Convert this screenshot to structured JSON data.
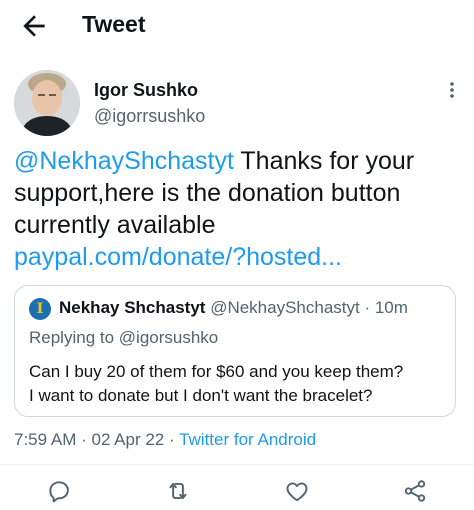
{
  "header": {
    "title": "Tweet",
    "back_icon": "arrow-left-icon"
  },
  "tweet": {
    "author": {
      "name": "Igor Sushko",
      "handle": "@igorrsushko"
    },
    "more_icon": "more-vertical-icon",
    "text": {
      "mention": "@NekhayShchastyt",
      "line1_rest": " Thanks for your",
      "line2": "support,here is the donation button",
      "line3": "currently available",
      "link": "paypal.com/donate/?hosted..."
    },
    "quoted": {
      "name": "Nekhay Shchastyt",
      "handle": "@NekhayShchastyt",
      "separator": " · ",
      "time": "10m",
      "replying_prefix": "Replying to ",
      "replying_to": "@igorsushko",
      "line1": "Can I buy 20 of them for $60 and you keep them?",
      "line2": "I want to donate but I don't want the bracelet?"
    },
    "meta": {
      "time": "7:59 AM",
      "sep1": " · ",
      "date": "02 Apr 22",
      "sep2": " · ",
      "source": "Twitter for Android"
    }
  },
  "actions": [
    {
      "icon": "reply-icon"
    },
    {
      "icon": "retweet-icon"
    },
    {
      "icon": "like-icon"
    },
    {
      "icon": "share-icon"
    }
  ],
  "colors": {
    "accent": "#1d9bf0",
    "text": "#0f1419",
    "muted": "#536471",
    "border": "#cfd9de"
  }
}
